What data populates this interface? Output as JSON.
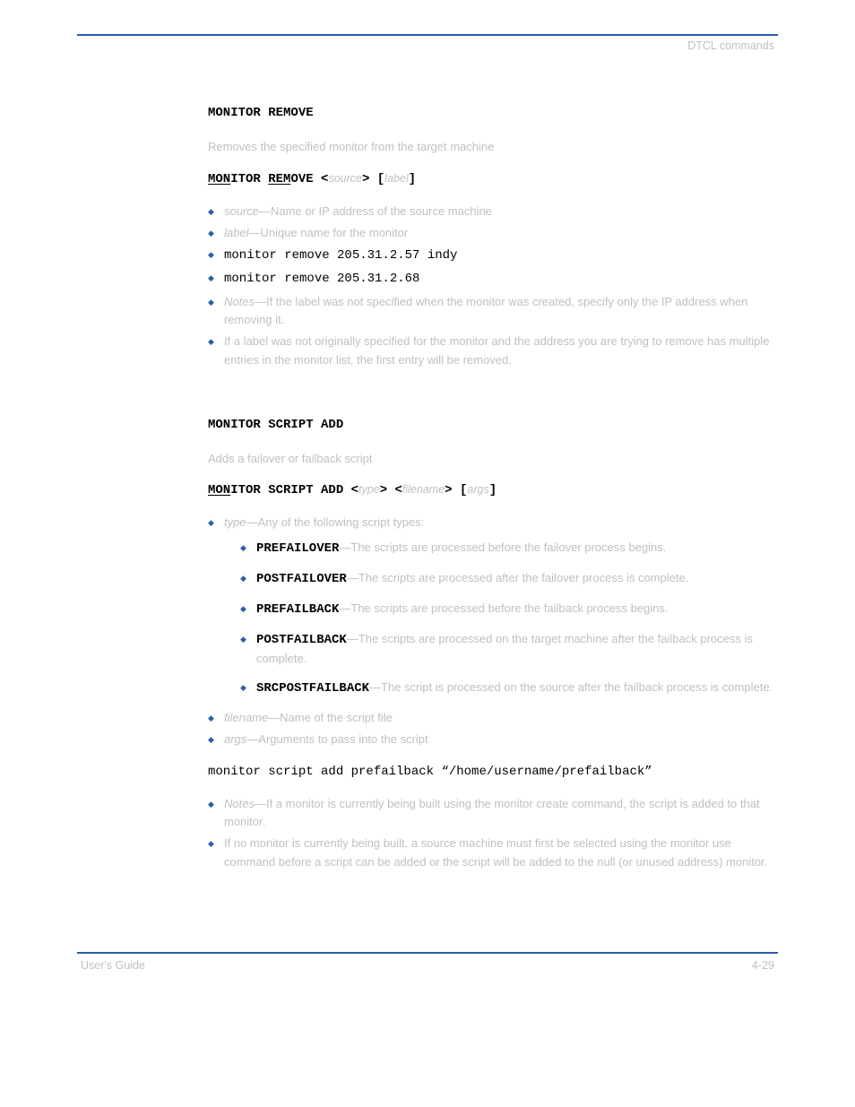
{
  "header": {
    "caption": "DTCL commands"
  },
  "footer": {
    "page": "4-29",
    "book": "User's Guide"
  },
  "sec1": {
    "title": "MONITOR REMOVE",
    "desc": "Removes the specified monitor from the target machine",
    "syntax_prefix1": "MON",
    "syntax_prefix2": "ITOR ",
    "syntax_prefix3": "REM",
    "syntax_prefix4": "OVE <",
    "arg_source": "source",
    "syntax_mid": "> [",
    "arg_label": "label",
    "syntax_end": "]",
    "b1_pre": "source",
    "b1_post": "—Name or IP address of the source machine",
    "b2_pre": "label",
    "b2_post": "—Unique name for the monitor",
    "ex1": "monitor remove 205.31.2.57 indy",
    "ex2": "monitor remove 205.31.2.68",
    "note1_pre": "Notes",
    "note1_post": "—If the label was not specified when the monitor was created, specify only the IP address when removing it.",
    "note2": "If a label was not originally specified for the monitor and the address you are trying to remove has multiple entries in the monitor list, the first entry will be removed."
  },
  "sec2": {
    "title": "MONITOR SCRIPT ADD",
    "desc": "Adds a failover or failback script",
    "syntax_prefix1": "MON",
    "syntax_prefix2": "ITOR SCRIPT ADD <",
    "arg_type": "type",
    "syntax_mid1": "> <",
    "arg_filename": "filename",
    "syntax_mid2": "> [",
    "arg_args": "args",
    "syntax_end": "]",
    "b_type_pre": "type",
    "b_type_post": "—Any of the following script types:",
    "sub1_b": "PREFAILOVER",
    "sub1_t": "—The scripts are processed before the failover process begins.",
    "sub2_b": "POSTFAILOVER",
    "sub2_t": "—The scripts are processed after the failover process is complete.",
    "sub3_b": "PREFAILBACK",
    "sub3_t": "—The scripts are processed before the failback process begins.",
    "sub4_b": "POSTFAILBACK",
    "sub4_t": "—The scripts are processed on the target machine after the failback process is complete.",
    "sub5_b": "SRCPOSTFAILBACK",
    "sub5_t": "—The script is processed on the source after the failback process is complete.",
    "b_file_pre": "filename",
    "b_file_post": "—Name of the script file",
    "b_args_pre": "args",
    "b_args_post": "—Arguments to pass into the script",
    "example": "monitor script add prefailback “/home/username/prefailback”",
    "note1_pre": "Notes",
    "note1_post": "—If a monitor is currently being built using the monitor create command, the script is added to that monitor.",
    "note2": "If no monitor is currently being built, a source machine must first be selected using the monitor use command before a script can be added or the script will be added to the null (or unused address) monitor."
  }
}
